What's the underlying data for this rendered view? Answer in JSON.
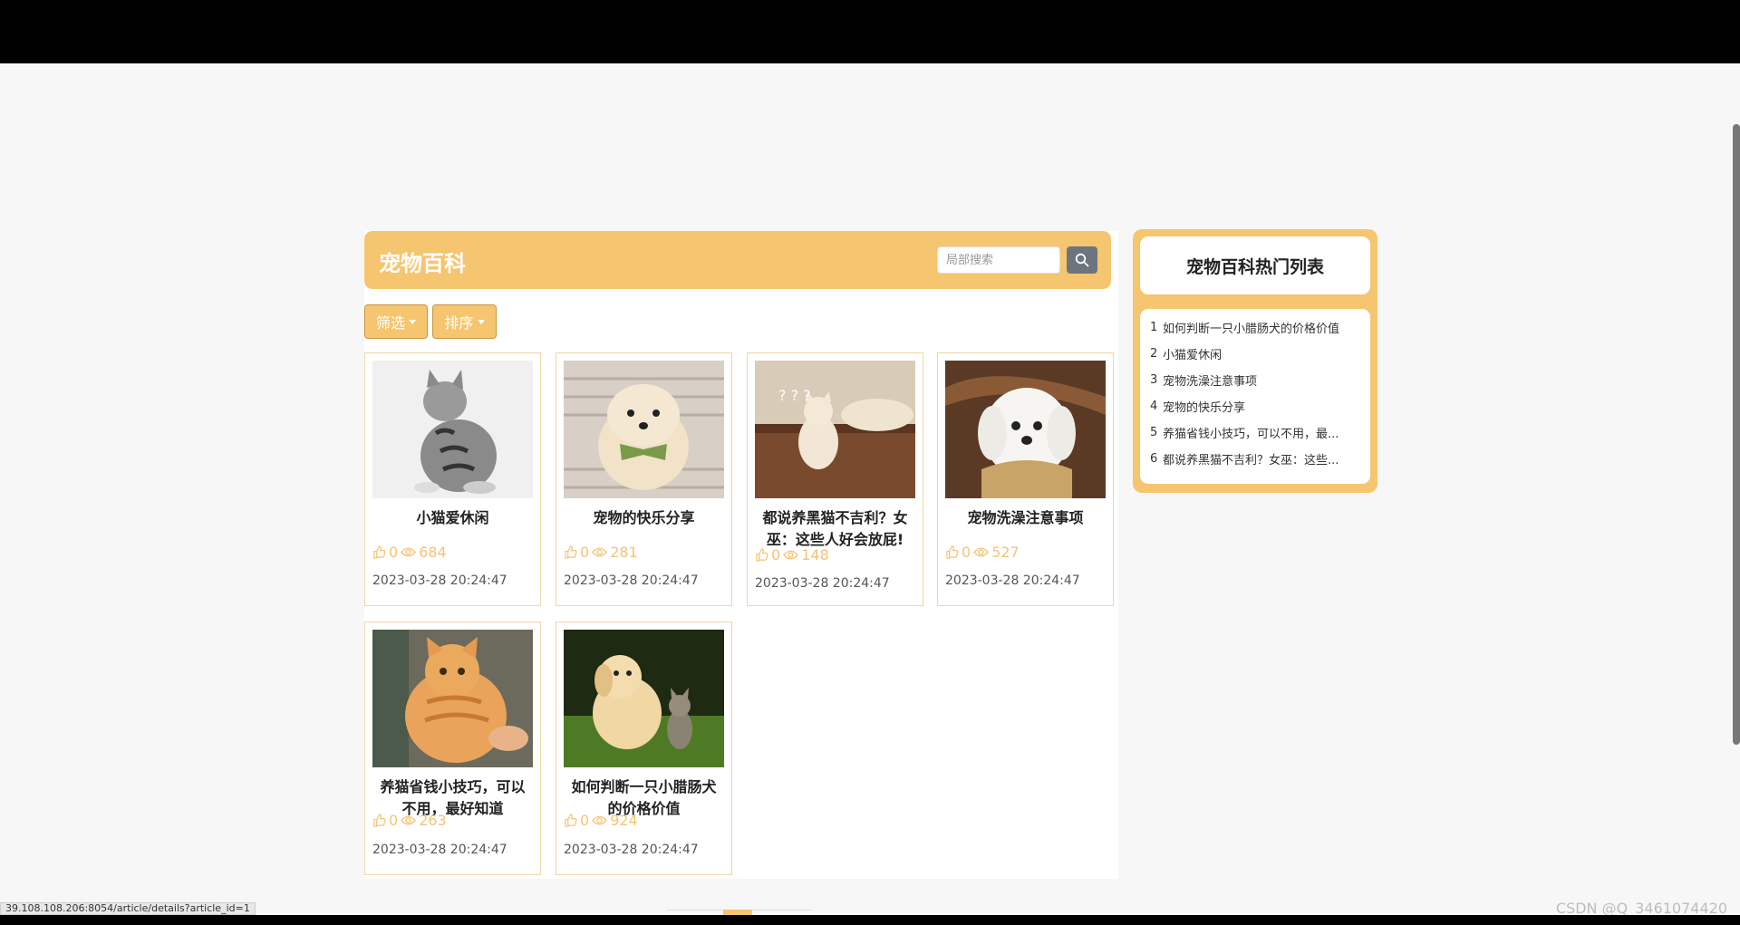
{
  "header": {
    "title": "宠物百科",
    "search_placeholder": "局部搜索"
  },
  "toolbar": {
    "filter_label": "筛选",
    "sort_label": "排序"
  },
  "articles": [
    {
      "title_lines": [
        "小猫爱休闲",
        ""
      ],
      "likes": "0",
      "views": "684",
      "date": "2023-03-28 20:24:47",
      "image": "gray-tabby-cat"
    },
    {
      "title_lines": [
        "宠物的快乐分享",
        ""
      ],
      "likes": "0",
      "views": "281",
      "date": "2023-03-28 20:24:47",
      "image": "pomeranian-puppy"
    },
    {
      "title_lines": [
        "都说养黑猫不吉利？女",
        "巫：这些人好会放屁!"
      ],
      "likes": "0",
      "views": "148",
      "date": "2023-03-28 20:24:47",
      "image": "confused-cat-on-stairs"
    },
    {
      "title_lines": [
        "宠物洗澡注意事项",
        ""
      ],
      "likes": "0",
      "views": "527",
      "date": "2023-03-28 20:24:47",
      "image": "white-maltese-puppy"
    },
    {
      "title_lines": [
        "养猫省钱小技巧，可以",
        "不用，最好知道"
      ],
      "likes": "0",
      "views": "263",
      "date": "2023-03-28 20:24:47",
      "image": "orange-tabby-cat"
    },
    {
      "title_lines": [
        "如何判断一只小腊肠犬",
        "的价格价值"
      ],
      "likes": "0",
      "views": "924",
      "date": "2023-03-28 20:24:47",
      "image": "puppy-and-kitten"
    }
  ],
  "hot_list": {
    "title": "宠物百科热门列表",
    "items": [
      {
        "num": "1",
        "text": "如何判断一只小腊肠犬的价格价值"
      },
      {
        "num": "2",
        "text": "小猫爱休闲"
      },
      {
        "num": "3",
        "text": "宠物洗澡注意事项"
      },
      {
        "num": "4",
        "text": "宠物的快乐分享"
      },
      {
        "num": "5",
        "text": "养猫省钱小技巧，可以不用，最..."
      },
      {
        "num": "6",
        "text": "都说养黑猫不吉利？女巫：这些..."
      }
    ]
  },
  "status_url": "39.108.108.206:8054/article/details?article_id=1",
  "watermark": "CSDN @Q_3461074420",
  "colors": {
    "accent": "#f6c56f",
    "stats": "#f3c476"
  }
}
